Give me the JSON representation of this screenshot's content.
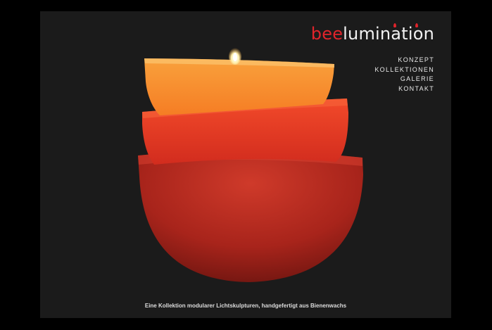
{
  "brand": {
    "prefix": "bee",
    "suffix": "lumination",
    "accent_color": "#e0242b"
  },
  "nav": {
    "items": [
      {
        "label": "KONZEPT"
      },
      {
        "label": "KOLLEKTIONEN"
      },
      {
        "label": "GALERIE"
      },
      {
        "label": "KONTAKT"
      }
    ]
  },
  "hero": {
    "image_icon": "stacked-wax-bowls-candle"
  },
  "caption": {
    "text": "Eine Kollektion modularer Lichtskulpturen, handgefertigt aus Bienenwachs"
  }
}
